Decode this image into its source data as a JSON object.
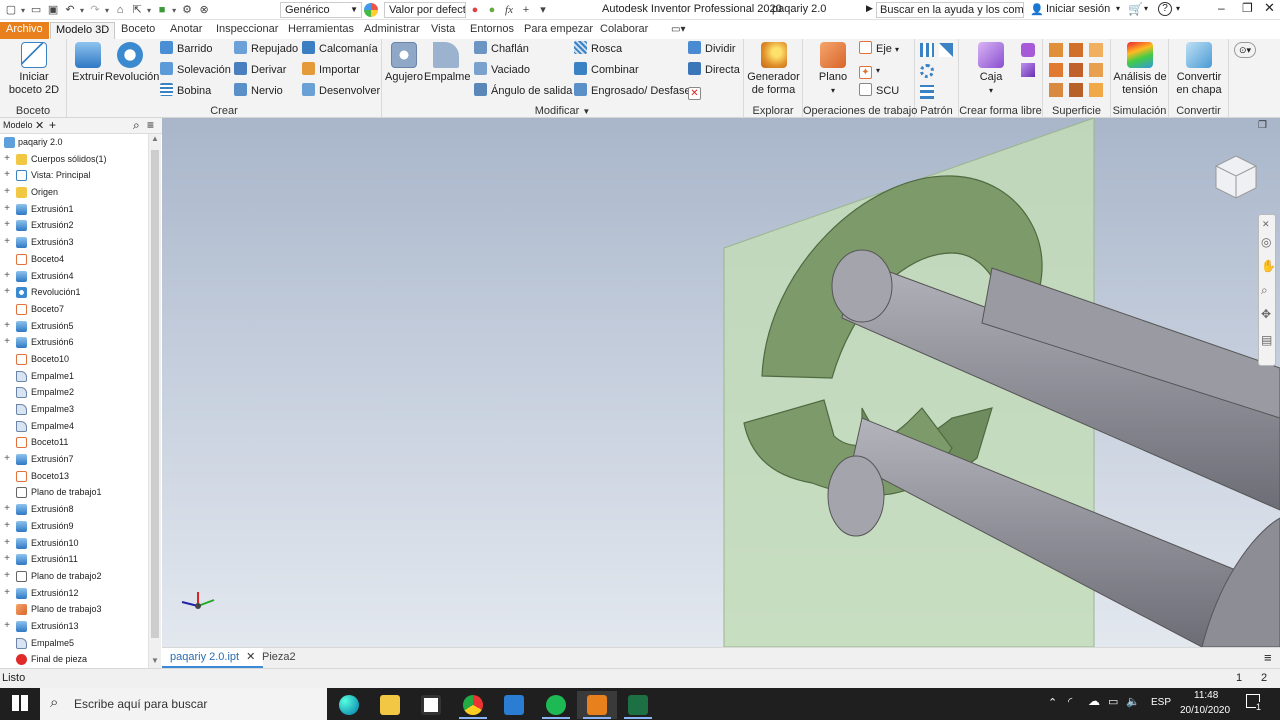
{
  "app": {
    "title": "Autodesk Inventor Professional 2020",
    "document": "paqariy 2.0",
    "search_placeholder": "Buscar en la ayuda y los comandos",
    "signin": "Iniciar sesión",
    "material_combo": "Genérico",
    "appearance_combo": "Valor por defecto"
  },
  "menu_tabs": [
    "Archivo",
    "Modelo 3D",
    "Boceto",
    "Anotar",
    "Inspeccionar",
    "Herramientas",
    "Administrar",
    "Vista",
    "Entornos",
    "Para empezar",
    "Colaborar"
  ],
  "ribbon": {
    "boceto": {
      "label": "Boceto",
      "start": "Iniciar boceto 2D"
    },
    "crear": {
      "label": "Crear",
      "extruir": "Extruir",
      "revolucion": "Revolución",
      "barrido": "Barrido",
      "solevacion": "Solevación",
      "bobina": "Bobina",
      "repujado": "Repujado",
      "derivar": "Derivar",
      "nervio": "Nervio",
      "calcomania": "Calcomanía",
      "importar": "Importar",
      "desenvolver": "Desenvolver"
    },
    "modificar": {
      "label": "Modificar",
      "agujero": "Agujero",
      "empalme": "Empalme",
      "chaflan": "Chaflán",
      "vaciado": "Vaciado",
      "angulo": "Ángulo de salida",
      "rosca": "Rosca",
      "combinar": "Combinar",
      "engrosado": "Engrosado/ Desfase",
      "dividir": "Dividir",
      "directa": "Directa"
    },
    "explorar": {
      "label": "Explorar",
      "generador": "Generador de forma"
    },
    "operaciones": {
      "label": "Operaciones de trabajo",
      "plano": "Plano",
      "eje": "Eje",
      "scu": "SCU"
    },
    "patron": {
      "label": "Patrón"
    },
    "forma_libre": {
      "label": "Crear forma libre",
      "caja": "Caja"
    },
    "superficie": {
      "label": "Superficie"
    },
    "simulacion": {
      "label": "Simulación",
      "analisis": "Análisis de tensión"
    },
    "convertir": {
      "label": "Convertir",
      "chapa": "Convertir en chapa"
    }
  },
  "browser": {
    "tab": "Modelo",
    "root": "paqariy 2.0",
    "items": [
      {
        "label": "Cuerpos sólidos(1)",
        "plus": true,
        "icon": "folder"
      },
      {
        "label": "Vista: Principal",
        "plus": true,
        "icon": "view"
      },
      {
        "label": "Origen",
        "plus": true,
        "icon": "folder"
      },
      {
        "label": "Extrusión1",
        "plus": true,
        "icon": "extrude"
      },
      {
        "label": "Extrusión2",
        "plus": true,
        "icon": "extrude"
      },
      {
        "label": "Extrusión3",
        "plus": true,
        "icon": "extrude"
      },
      {
        "label": "Boceto4",
        "plus": false,
        "icon": "sketch"
      },
      {
        "label": "Extrusión4",
        "plus": true,
        "icon": "extrude"
      },
      {
        "label": "Revolución1",
        "plus": true,
        "icon": "revolve"
      },
      {
        "label": "Boceto7",
        "plus": false,
        "icon": "sketch"
      },
      {
        "label": "Extrusión5",
        "plus": true,
        "icon": "extrude"
      },
      {
        "label": "Extrusión6",
        "plus": true,
        "icon": "extrude"
      },
      {
        "label": "Boceto10",
        "plus": false,
        "icon": "sketch"
      },
      {
        "label": "Empalme1",
        "plus": false,
        "icon": "fillet"
      },
      {
        "label": "Empalme2",
        "plus": false,
        "icon": "fillet"
      },
      {
        "label": "Empalme3",
        "plus": false,
        "icon": "fillet"
      },
      {
        "label": "Empalme4",
        "plus": false,
        "icon": "fillet"
      },
      {
        "label": "Boceto11",
        "plus": false,
        "icon": "sketch"
      },
      {
        "label": "Extrusión7",
        "plus": true,
        "icon": "extrude"
      },
      {
        "label": "Boceto13",
        "plus": false,
        "icon": "sketch"
      },
      {
        "label": "Plano de trabajo1",
        "plus": false,
        "icon": "plane"
      },
      {
        "label": "Extrusión8",
        "plus": true,
        "icon": "extrude"
      },
      {
        "label": "Extrusión9",
        "plus": true,
        "icon": "extrude"
      },
      {
        "label": "Extrusión10",
        "plus": true,
        "icon": "extrude"
      },
      {
        "label": "Extrusión11",
        "plus": true,
        "icon": "extrude"
      },
      {
        "label": "Plano de trabajo2",
        "plus": true,
        "icon": "plane"
      },
      {
        "label": "Extrusión12",
        "plus": true,
        "icon": "extrude"
      },
      {
        "label": "Plano de trabajo3",
        "plus": false,
        "icon": "plane2"
      },
      {
        "label": "Extrusión13",
        "plus": true,
        "icon": "extrude"
      },
      {
        "label": "Empalme5",
        "plus": false,
        "icon": "fillet"
      },
      {
        "label": "Final de pieza",
        "plus": false,
        "icon": "end"
      }
    ]
  },
  "doc_tabs": [
    "paqariy 2.0.ipt",
    "Pieza2"
  ],
  "status": {
    "text": "Listo",
    "page1": "1",
    "page2": "2"
  },
  "taskbar": {
    "search": "Escribe aquí para buscar",
    "lang": "ESP",
    "time": "11:48",
    "date": "20/10/2020",
    "notif": "1"
  },
  "colors": {
    "accent": "#e8811d",
    "model_green": "#7d9a6a",
    "rod_gray": "#8d8d96",
    "plane_green": "#c3dcb8"
  }
}
